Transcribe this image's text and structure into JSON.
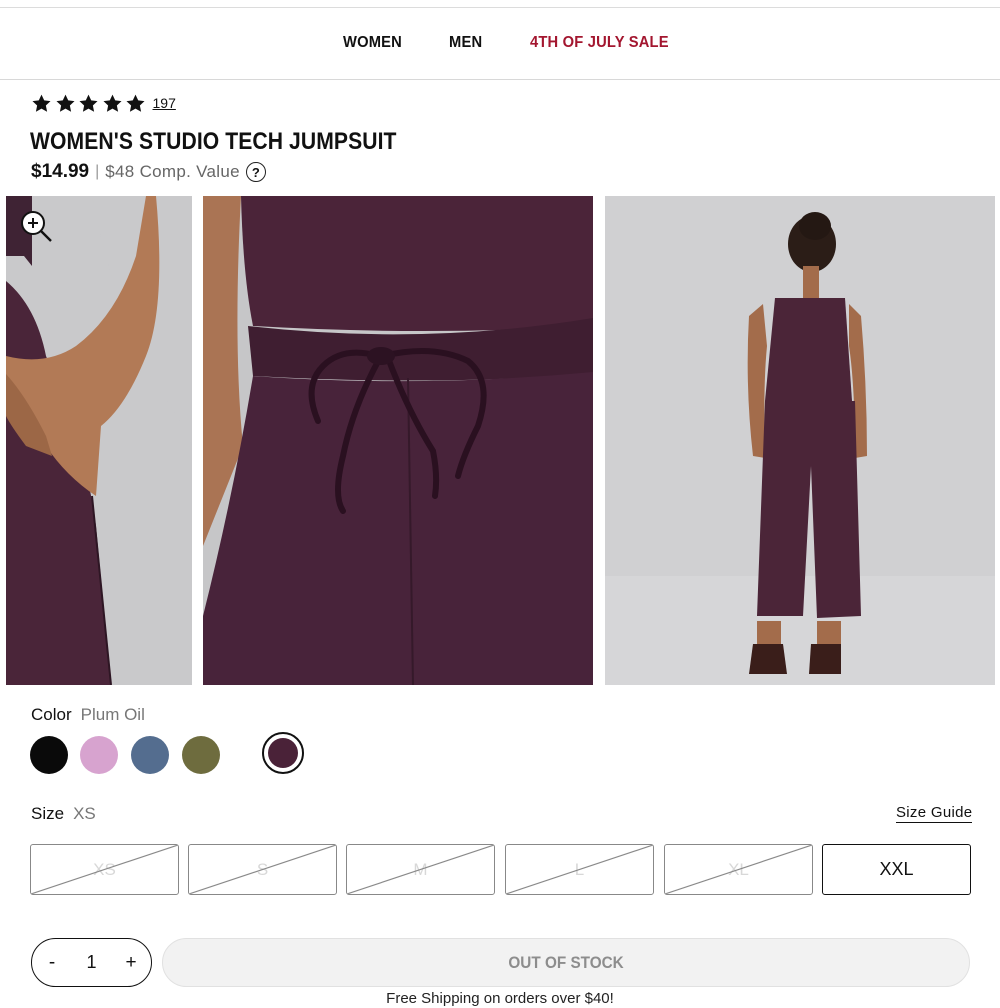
{
  "nav": {
    "women": "WOMEN",
    "men": "MEN",
    "sale": "4TH OF JULY SALE"
  },
  "product": {
    "rating_stars": 5,
    "review_count": "197",
    "title": "WOMEN'S STUDIO TECH JUMPSUIT",
    "price": "$14.99",
    "separator": "|",
    "comp_value": "$48 Comp. Value",
    "help_icon": "?"
  },
  "gallery": {
    "zoom_icon": "zoom-in-icon"
  },
  "color": {
    "label": "Color",
    "selected": "Plum Oil",
    "swatches": [
      "#0a0a0a",
      "#d7a3cf",
      "#546d8f",
      "#6e6c3e",
      "#4a2238"
    ],
    "selected_index": 4
  },
  "size": {
    "label": "Size",
    "selected": "XS",
    "guide": "Size Guide",
    "options": [
      {
        "label": "XS",
        "available": false
      },
      {
        "label": "S",
        "available": false
      },
      {
        "label": "M",
        "available": false
      },
      {
        "label": "L",
        "available": false
      },
      {
        "label": "XL",
        "available": false
      },
      {
        "label": "XXL",
        "available": true
      }
    ]
  },
  "quantity": {
    "minus": "-",
    "value": "1",
    "plus": "+"
  },
  "cta": {
    "label": "OUT OF STOCK"
  },
  "shipping_note": "Free Shipping on orders over $40!"
}
